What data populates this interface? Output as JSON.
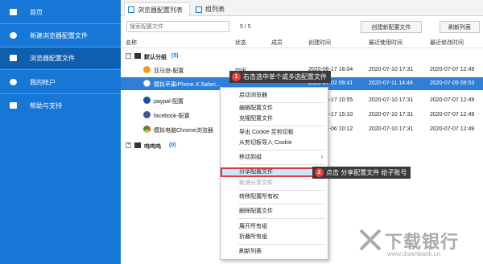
{
  "sidebar": {
    "items": [
      {
        "label": "首页",
        "icon": "home-icon"
      },
      {
        "label": "新建浏览器配置文件",
        "icon": "plus-circle-icon"
      },
      {
        "label": "浏览器配置文件",
        "icon": "folder-icon"
      },
      {
        "label": "我的帐户",
        "icon": "user-icon"
      },
      {
        "label": "帮助与支持",
        "icon": "help-icon"
      }
    ],
    "active_index": 2
  },
  "tabs": [
    {
      "label": "浏览器配置列表",
      "icon": "list-icon"
    },
    {
      "label": "组列表",
      "icon": "group-icon"
    }
  ],
  "toolbar": {
    "search_placeholder": "搜索配置文件",
    "pager": "5 / 5",
    "create_button": "创建新配置文件",
    "refresh_button": "刷新列表"
  },
  "table": {
    "columns": [
      "名称",
      "状态",
      "成员",
      "创建时间",
      "最近使用时间",
      "最近修改时间"
    ],
    "groups": [
      {
        "name": "默认分组",
        "count": "(5)",
        "rows": [
          {
            "name": "亚马逊-配置",
            "status": "空闲",
            "created": "2020-06-17 16:04",
            "used": "2020-07-10 17:31",
            "modified": "2020-07-07 12:49"
          },
          {
            "name": "模拟苹果iPhone X Safari...",
            "status": "",
            "created": "2020-07-02 09:41",
            "used": "2020-07-11 14:49",
            "modified": "2020-07-09 09:53"
          },
          {
            "name": "paypal-配置",
            "status": "",
            "created": "2020-06-17 10:55",
            "used": "2020-07-10 17:31",
            "modified": "2020-07-07 12:49"
          },
          {
            "name": "facebook-配置",
            "status": "",
            "created": "2020-06-17 15:10",
            "used": "2020-07-10 17:31",
            "modified": "2020-07-07 12:49"
          },
          {
            "name": "模拟电脑Chrome浏览器",
            "status": "",
            "created": "2020-07-06 10:12",
            "used": "2020-07-10 17:31",
            "modified": "2020-07-07 12:49"
          }
        ]
      },
      {
        "name": "呜呜呜",
        "count": "(0)",
        "rows": []
      }
    ]
  },
  "context_menu": {
    "items": [
      {
        "label": "启动浏览器",
        "disabled": false
      },
      {
        "label": "编辑配置文件",
        "disabled": false
      },
      {
        "label": "克隆配置文件",
        "disabled": false
      },
      {
        "label": "导出 Cookie 至剪切板",
        "disabled": false
      },
      {
        "label": "从剪切板导入 Cookie",
        "disabled": false
      },
      {
        "label": "移动到组",
        "disabled": false,
        "submenu": true
      },
      {
        "label": "分享配置文件",
        "disabled": false,
        "highlighted": true
      },
      {
        "label": "取消分享文件",
        "disabled": true
      },
      {
        "label": "转移配置所有权",
        "disabled": false
      },
      {
        "label": "删除配置文件",
        "disabled": false
      },
      {
        "label": "展开所有组",
        "disabled": false
      },
      {
        "label": "折叠所有组",
        "disabled": false
      },
      {
        "label": "刷新列表",
        "disabled": false
      }
    ]
  },
  "callouts": [
    {
      "num": "1",
      "text": "右击选中单个或多选配置文件"
    },
    {
      "num": "2",
      "text": "点击 分享配置文件 给子账号"
    }
  ],
  "watermark": {
    "title": "下载银行",
    "sub": "www.downbank.cn"
  },
  "colors": {
    "sidebar": "#1677d6",
    "sidebar_active": "#0e5fb0",
    "selected_row": "#2f7fd9",
    "callout_num": "#e94040"
  }
}
